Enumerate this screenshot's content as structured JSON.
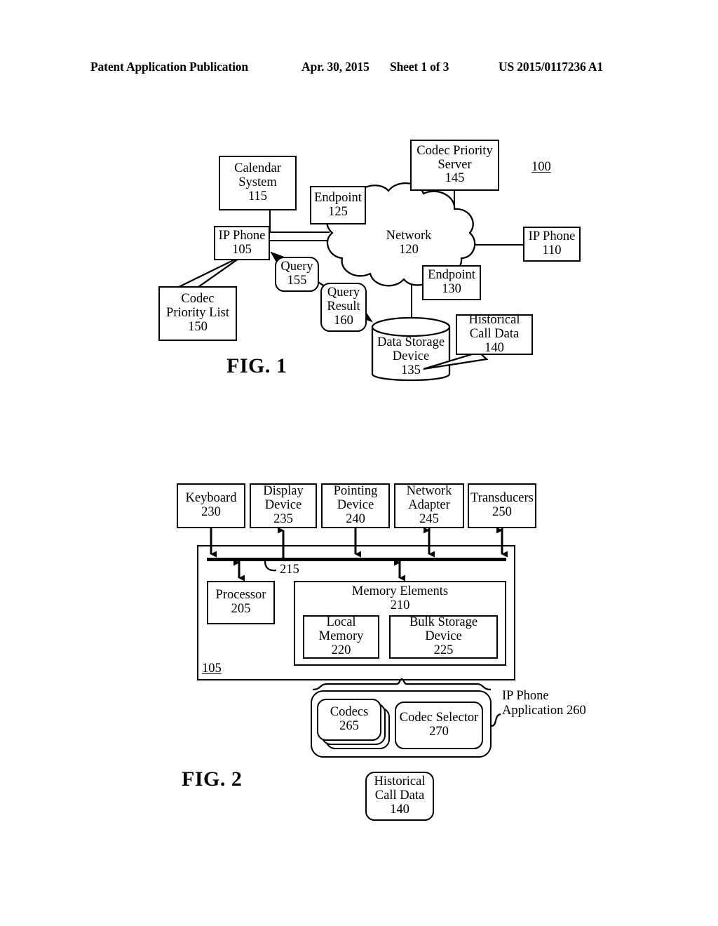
{
  "header": {
    "publication": "Patent Application Publication",
    "date": "Apr. 30, 2015",
    "sheet": "Sheet 1 of 3",
    "patent_number": "US 2015/0117236 A1"
  },
  "figure1": {
    "caption": "FIG. 1",
    "system_ref": "100",
    "nodes": {
      "calendar_system": {
        "line1": "Calendar",
        "line2": "System",
        "ref": "115"
      },
      "endpoint_125": {
        "line1": "Endpoint",
        "ref": "125"
      },
      "codec_priority_server": {
        "line1": "Codec Priority",
        "line2": "Server",
        "ref": "145"
      },
      "ip_phone_105": {
        "line1": "IP Phone",
        "ref": "105"
      },
      "ip_phone_110": {
        "line1": "IP Phone",
        "ref": "110"
      },
      "network": {
        "line1": "Network",
        "ref": "120"
      },
      "endpoint_130": {
        "line1": "Endpoint",
        "ref": "130"
      },
      "query": {
        "line1": "Query",
        "ref": "155"
      },
      "query_result": {
        "line1": "Query",
        "line2": "Result",
        "ref": "160"
      },
      "codec_priority_list": {
        "line1": "Codec",
        "line2": "Priority List",
        "ref": "150"
      },
      "data_storage_device": {
        "line1": "Data Storage",
        "line2": "Device",
        "ref": "135"
      },
      "historical_call_data": {
        "line1": "Historical",
        "line2": "Call Data",
        "ref": "140"
      }
    }
  },
  "figure2": {
    "caption": "FIG. 2",
    "nodes": {
      "keyboard": {
        "line1": "Keyboard",
        "ref": "230"
      },
      "display_device": {
        "line1": "Display",
        "line2": "Device",
        "ref": "235"
      },
      "pointing_device": {
        "line1": "Pointing",
        "line2": "Device",
        "ref": "240"
      },
      "network_adapter": {
        "line1": "Network",
        "line2": "Adapter",
        "ref": "245"
      },
      "transducers": {
        "line1": "Transducers",
        "ref": "250"
      },
      "processor": {
        "line1": "Processor",
        "ref": "205"
      },
      "memory_elements": {
        "line1": "Memory Elements",
        "ref": "210"
      },
      "local_memory": {
        "line1": "Local",
        "line2": "Memory",
        "ref": "220"
      },
      "bulk_storage_device": {
        "line1": "Bulk Storage",
        "line2": "Device",
        "ref": "225"
      },
      "codecs": {
        "line1": "Codecs",
        "ref": "265"
      },
      "codec_selector": {
        "line1": "Codec Selector",
        "ref": "270"
      },
      "historical_call_data": {
        "line1": "Historical",
        "line2": "Call Data",
        "ref": "140"
      }
    },
    "labels": {
      "bus_ref": "215",
      "enclosure_ref": "105",
      "ip_phone_application": {
        "line1": "IP Phone",
        "line2": "Application",
        "ref": "260"
      }
    }
  }
}
